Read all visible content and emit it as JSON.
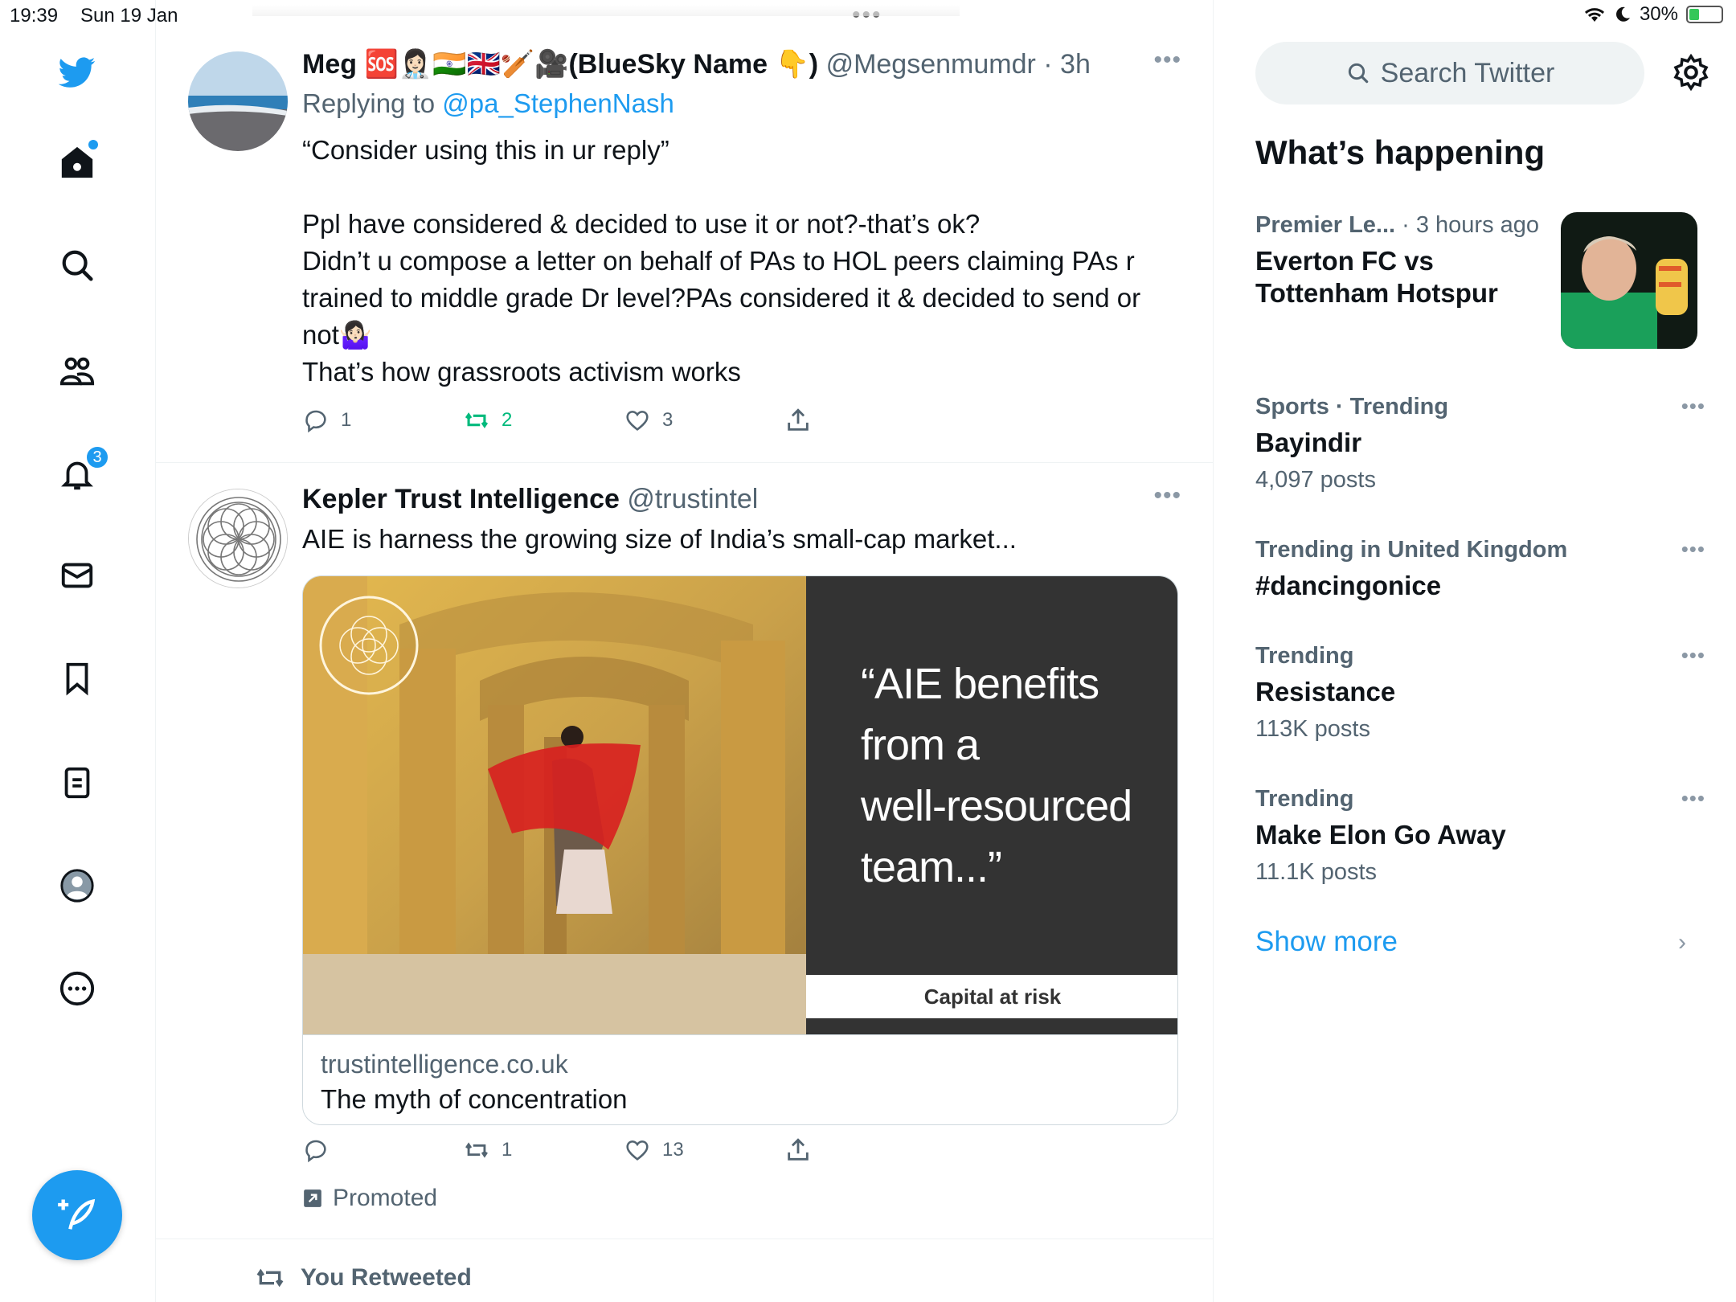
{
  "status": {
    "time": "19:39",
    "date": "Sun 19 Jan",
    "battery": "30%"
  },
  "nav": {
    "notifications_badge": "3"
  },
  "tweets": [
    {
      "name": "Meg 🆘👩🏻‍⚕️🇮🇳🇬🇧🏏🎥(BlueSky Name 👇)",
      "handle": "@Megsenmumdr",
      "time": "· 3h",
      "replying_label": "Replying to",
      "replying_to": "@pa_StephenNash",
      "lines": [
        "“Consider using this in ur reply”",
        "",
        "Ppl have considered & decided to use it or not?-that’s ok?",
        "Didn’t u compose a letter on behalf of PAs to HOL peers claiming PAs r trained to middle grade Dr level?PAs considered it & decided to send or not🤷🏻‍♀️",
        "That’s how grassroots activism works"
      ],
      "replies": "1",
      "retweets": "2",
      "likes": "3"
    },
    {
      "name": "Kepler Trust Intelligence",
      "handle": "@trustintel",
      "text": "AIE is harness the growing size of India’s small-cap market...",
      "card_quote": [
        "“AIE benefits",
        "from a",
        "well-resourced",
        "team...”"
      ],
      "card_risk": "Capital at risk",
      "card_domain": "trustintelligence.co.uk",
      "card_title": "The myth of concentration",
      "replies": "",
      "retweets": "1",
      "likes": "13",
      "promoted": "Promoted"
    }
  ],
  "retweeted_label": "You Retweeted",
  "sidebar": {
    "search_placeholder": "Search Twitter",
    "heading": "What’s happening",
    "trends": [
      {
        "context": "Premier Le...",
        "context_light": " · 3 hours ago",
        "title": "Everton FC vs Tottenham Hotspur",
        "count": ""
      },
      {
        "context": "Sports · Trending",
        "context_light": "",
        "title": "Bayindir",
        "count": "4,097 posts"
      },
      {
        "context": "Trending in United Kingdom",
        "context_light": "",
        "title": "#dancingonice",
        "count": ""
      },
      {
        "context": "Trending",
        "context_light": "",
        "title": "Resistance",
        "count": "113K posts"
      },
      {
        "context": "Trending",
        "context_light": "",
        "title": "Make Elon Go Away",
        "count": "11.1K posts"
      }
    ],
    "show_more": "Show more"
  },
  "colors": {
    "accent": "#1d9bf0",
    "retweet_green": "#00ba7c",
    "secondary_text": "#536471"
  }
}
